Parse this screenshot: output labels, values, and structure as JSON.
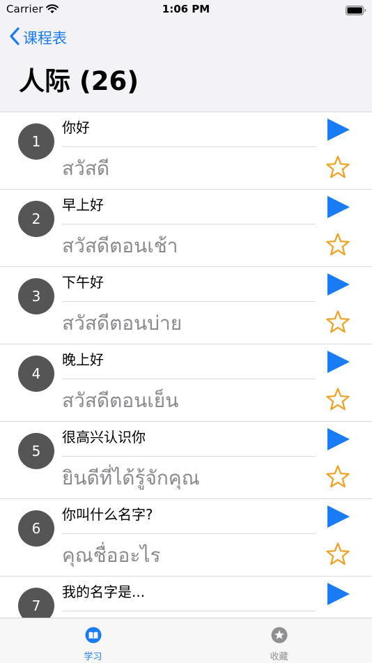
{
  "status_bar": {
    "carrier": "Carrier",
    "time": "1:06 PM"
  },
  "nav": {
    "back_label": "课程表",
    "title": "人际 (26)"
  },
  "colors": {
    "accent": "#1a7cf5",
    "star": "#f0a01e",
    "circle": "#555555",
    "thai_text": "#8a8a8e"
  },
  "icons": {
    "back": "chevron-left-icon",
    "play": "play-icon",
    "favorite": "star-outline-icon",
    "tab_learn": "book-icon",
    "tab_favorites": "star-circle-icon"
  },
  "phrases": [
    {
      "number": "1",
      "chinese": "你好",
      "thai": "สวัสดี"
    },
    {
      "number": "2",
      "chinese": "早上好",
      "thai": "สวัสดีตอนเช้า"
    },
    {
      "number": "3",
      "chinese": "下午好",
      "thai": "สวัสดีตอนบ่าย"
    },
    {
      "number": "4",
      "chinese": "晚上好",
      "thai": "สวัสดีตอนเย็น"
    },
    {
      "number": "5",
      "chinese": "很高兴认识你",
      "thai": "ยินดีที่ได้รู้จักคุณ"
    },
    {
      "number": "6",
      "chinese": "你叫什么名字?",
      "thai": "คุณชื่ออะไร"
    },
    {
      "number": "7",
      "chinese": "我的名字是...",
      "thai": ""
    }
  ],
  "tabs": [
    {
      "label": "学习",
      "active": true
    },
    {
      "label": "收藏",
      "active": false
    }
  ]
}
